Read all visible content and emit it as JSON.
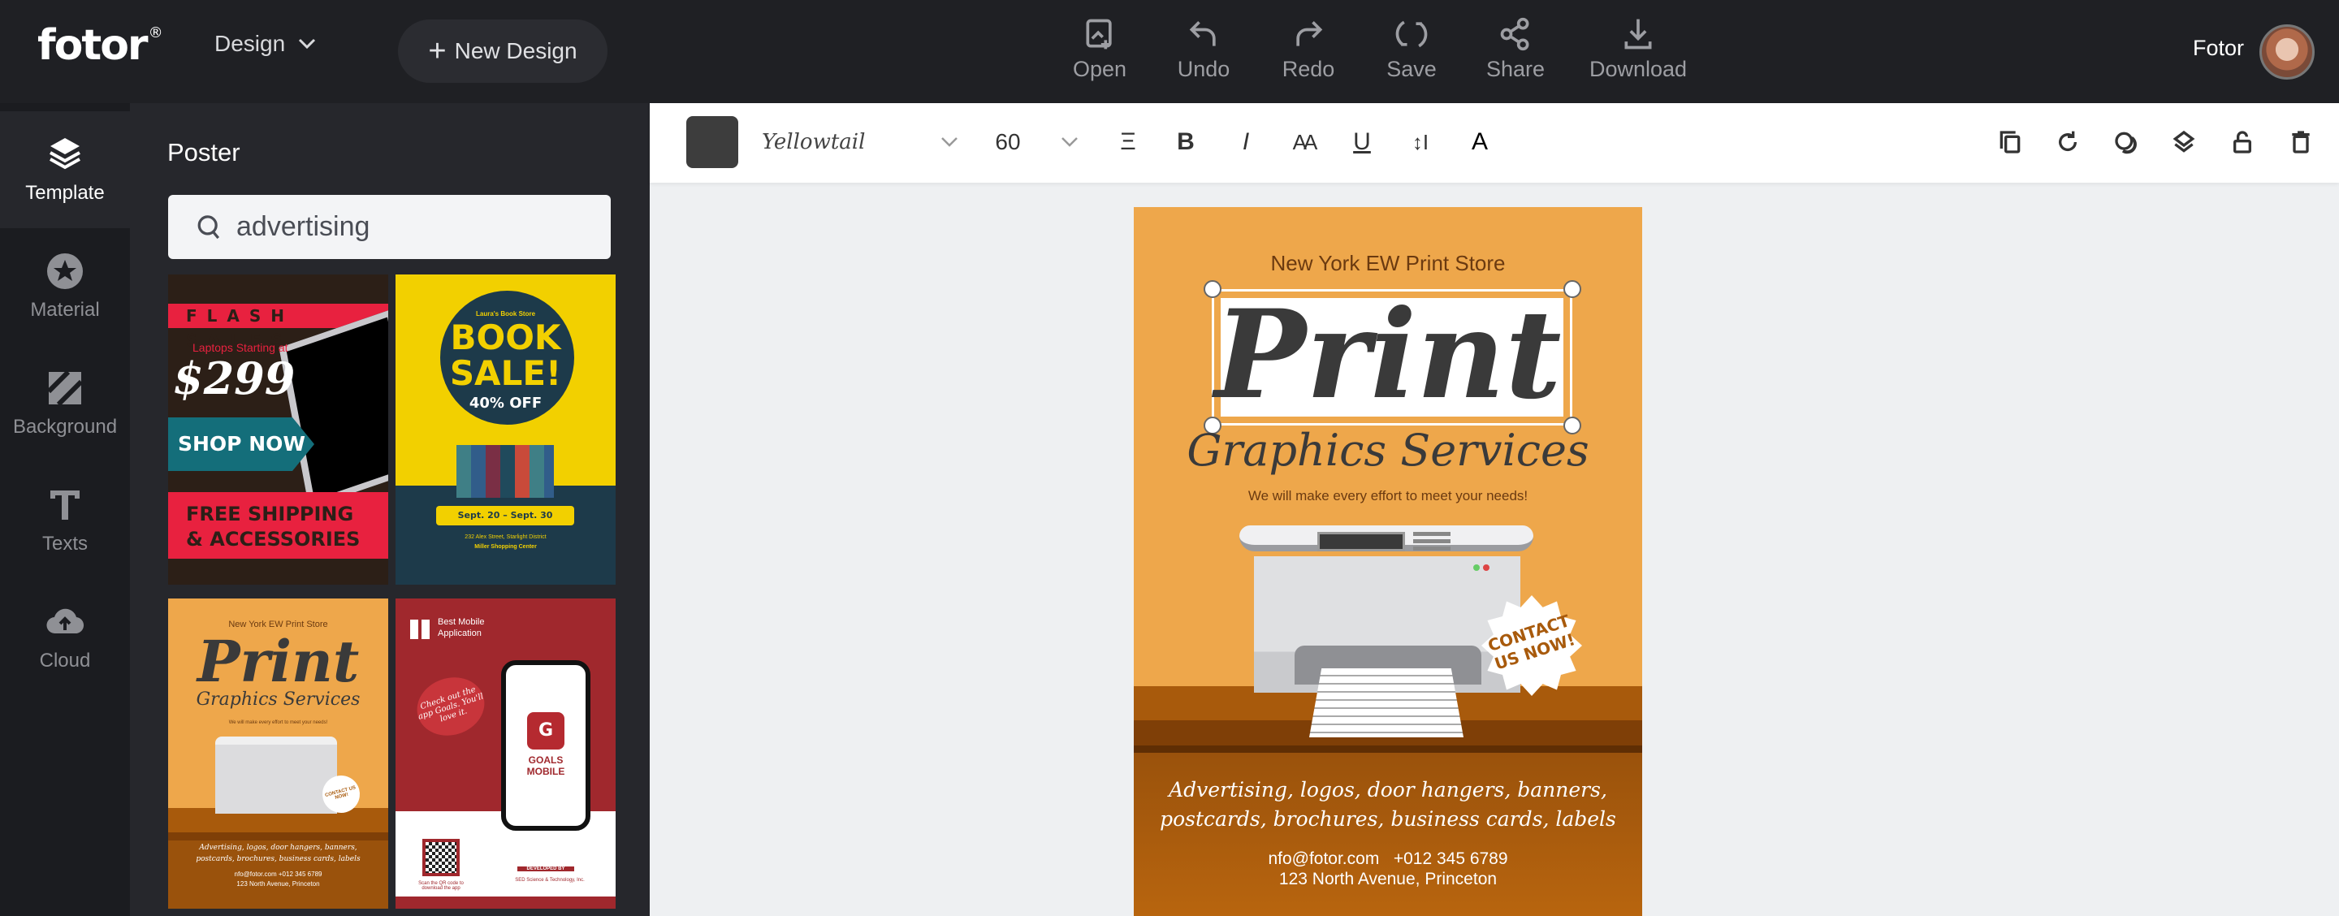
{
  "header": {
    "logo": "fotor",
    "logo_mark": "®",
    "design_menu": "Design",
    "new_design": "New Design",
    "tools": [
      {
        "label": "Open",
        "icon": "open-image-icon"
      },
      {
        "label": "Undo",
        "icon": "undo-icon"
      },
      {
        "label": "Redo",
        "icon": "redo-icon"
      },
      {
        "label": "Save",
        "icon": "save-sync-icon"
      },
      {
        "label": "Share",
        "icon": "share-icon"
      },
      {
        "label": "Download",
        "icon": "download-icon"
      }
    ],
    "user_name": "Fotor"
  },
  "sidebar": {
    "items": [
      {
        "label": "Template",
        "icon": "layers-icon",
        "active": true
      },
      {
        "label": "Material",
        "icon": "star-icon"
      },
      {
        "label": "Background",
        "icon": "hatch-icon"
      },
      {
        "label": "Texts",
        "icon": "text-t-icon"
      },
      {
        "label": "Cloud",
        "icon": "cloud-upload-icon"
      }
    ]
  },
  "panel": {
    "title": "Poster",
    "search_value": "advertising",
    "templates": [
      {
        "flash": "FLASH SALES",
        "laptops": "Laptops Starting at",
        "price": "$299",
        "shop": "SHOP NOW",
        "ship1": "FREE SHIPPING",
        "ship2": "& ACCESSORIES"
      },
      {
        "store": "Laura's Book Store",
        "book": "BOOK",
        "sale": "SALE!",
        "off": "40% OFF",
        "dates": "Sept. 20 – Sept. 30",
        "addr": "232 Alex Street, Starlight District",
        "center": "Miller Shopping Center"
      },
      {
        "store": "New York EW Print Store",
        "print": "Print",
        "graphics": "Graphics Services",
        "tagline": "We will make every effort to meet your needs!",
        "contact": "CONTACT US NOW!",
        "services1": "Advertising, logos, door hangers, banners,",
        "services2": "postcards, brochures, business cards, labels",
        "contact_line": "nfo@fotor.com   +012 345 6789",
        "address": "123 North Avenue, Princeton"
      },
      {
        "badge": "Best Mobile Application",
        "bubble": "Check out the app Goals. You'll love it.",
        "app_letter": "G",
        "app_name": "GOALS MOBILE",
        "scan": "Scan the QR code to download the app",
        "dev": "DEVELOPED BY",
        "company": "SED Science & Technology, Inc."
      }
    ]
  },
  "toolbar": {
    "text_color": "#3d3d3d",
    "font": "Yellowtail",
    "font_size": "60",
    "format_icons": [
      "align-icon",
      "bold-icon",
      "italic-icon",
      "letter-case-icon",
      "underline-icon",
      "line-spacing-icon",
      "text-color-icon"
    ],
    "format_glyphs": [
      "Ξ",
      "B",
      "I",
      "AA",
      "U",
      "↕I",
      "A"
    ],
    "object_icons": [
      "duplicate-icon",
      "rotate-icon",
      "opacity-icon",
      "layers-icon",
      "lock-icon",
      "delete-icon"
    ]
  },
  "poster": {
    "store": "New York EW Print Store",
    "print": "Print",
    "graphics": "Graphics Services",
    "tagline": "We will make every effort to meet your needs!",
    "contact1": "CONTACT",
    "contact2": "US NOW!",
    "services1": "Advertising, logos, door hangers, banners,",
    "services2": "postcards, brochures, business cards, labels",
    "contact_line": "nfo@fotor.com   +012 345 6789",
    "address": "123 North Avenue, Princeton"
  },
  "colors": {
    "topbar": "#1f2024",
    "panel": "#26272c",
    "poster_orange": "#eea74b",
    "poster_brown": "#a85a0c",
    "accent_text": "#6b3a10"
  }
}
